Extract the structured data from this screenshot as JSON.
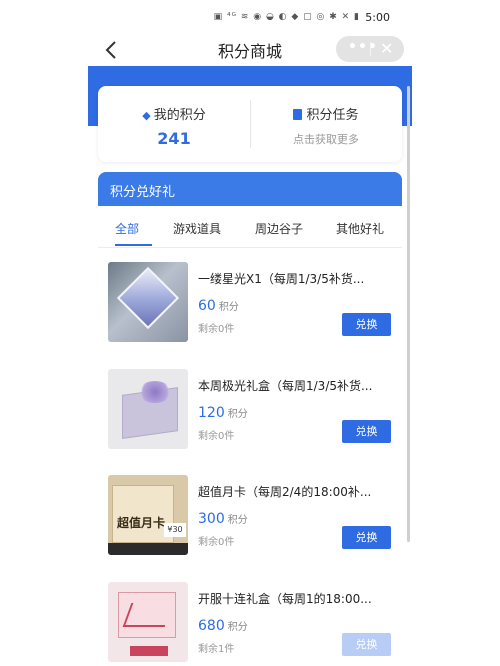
{
  "status_bar": {
    "icons": "▣ ⁴ᴳ ≋ ◉ ◒ ◐ ◆ ▢ ◎ ✱ ✕ ▮",
    "time": "5:00"
  },
  "nav": {
    "title": "积分商城",
    "more_icon": "more-dots-icon",
    "close_icon": "close-icon"
  },
  "points_card": {
    "my_points_label": "我的积分",
    "my_points_value": "241",
    "task_label": "积分任务",
    "task_sub": "点击获取更多"
  },
  "gifts": {
    "header": "积分兑好礼",
    "tabs": [
      "全部",
      "游戏道具",
      "周边谷子",
      "其他好礼"
    ],
    "active_tab": 0,
    "items": [
      {
        "title": "一缕星光X1（每周1/3/5补货...",
        "price": "60",
        "unit": "积分",
        "stock": "剩余0件",
        "button": "兑换"
      },
      {
        "title": "本周极光礼盒（每周1/3/5补货...",
        "price": "120",
        "unit": "积分",
        "stock": "剩余0件",
        "button": "兑换"
      },
      {
        "title": "超值月卡（每周2/4的18:00补...",
        "price": "300",
        "unit": "积分",
        "stock": "剩余0件",
        "button": "兑换",
        "thumb_text": "超值月卡",
        "thumb_price": "¥30"
      },
      {
        "title": "开服十连礼盒（每周1的18:00...",
        "price": "680",
        "unit": "积分",
        "stock": "剩余1件",
        "button": "兑换"
      }
    ]
  },
  "colors": {
    "accent": "#2f6be3",
    "header_blue": "#3a7be8"
  }
}
